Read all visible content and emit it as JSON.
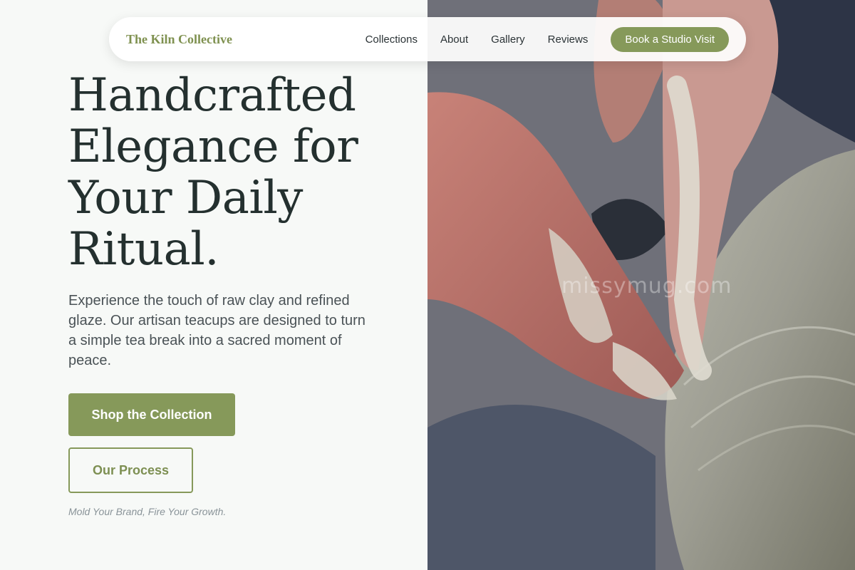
{
  "nav": {
    "brand": "The Kiln Collective",
    "links": [
      "Collections",
      "About",
      "Gallery",
      "Reviews"
    ],
    "cta": "Book a Studio Visit"
  },
  "hero": {
    "headline": "Handcrafted Elegance for Your Daily Ritual.",
    "subtext": "Experience the touch of raw clay and refined glaze. Our artisan teacups are designed to turn a simple tea break into a sacred moment of peace.",
    "primary_button": "Shop the Collection",
    "secondary_button": "Our Process",
    "tagline": "Mold Your Brand, Fire Your Growth."
  },
  "image": {
    "watermark": "missymug.com"
  },
  "colors": {
    "accent": "#86995a",
    "brand_text": "#7f9150",
    "headline": "#24302f",
    "background": "#f7f9f7"
  }
}
